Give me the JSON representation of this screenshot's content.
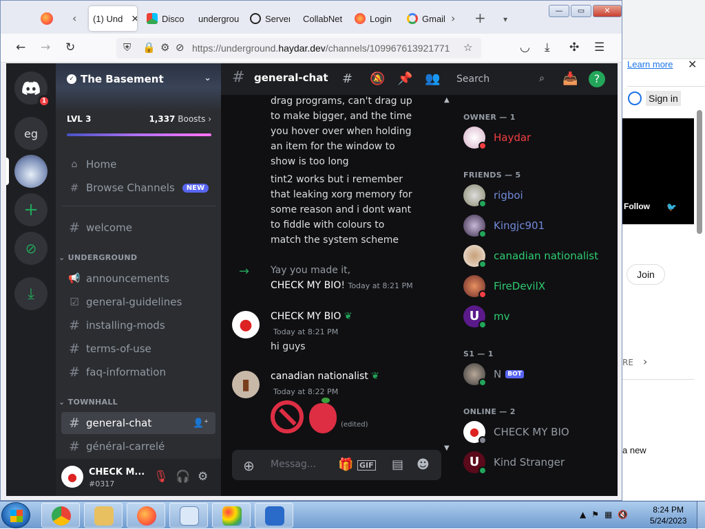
{
  "background_page": {
    "learn_more": "Learn more",
    "sign_in": "Sign in",
    "follow": "Follow",
    "join": "Join",
    "partial_text_1": "RE",
    "partial_text_2": "a new"
  },
  "browser": {
    "tabs": [
      {
        "label": "(1) Und",
        "active": true
      },
      {
        "label": "Disco"
      },
      {
        "label": "undergrou"
      },
      {
        "label": "Server"
      },
      {
        "label": "CollabNet"
      },
      {
        "label": "Login"
      },
      {
        "label": "Gmail"
      }
    ],
    "url_prefix": "https://underground.",
    "url_domain": "haydar.dev",
    "url_suffix": "/channels/109967613921771",
    "window_buttons": {
      "minimize": "—",
      "restore": "▭",
      "close": "✕"
    }
  },
  "discord": {
    "guild_badge": "1",
    "guild_eg": "eg",
    "server_name": "The Basement",
    "boost_level": "LVL 3",
    "boost_count": "1,337",
    "boost_word": "Boosts",
    "nav": {
      "home": "Home",
      "browse": "Browse Channels",
      "new_tag": "NEW"
    },
    "channels_top": [
      {
        "name": "welcome"
      }
    ],
    "categories": {
      "underground": "UNDERGROUND",
      "townhall": "TOWNHALL"
    },
    "channels_underground": [
      {
        "name": "announcements"
      },
      {
        "name": "general-guidelines"
      },
      {
        "name": "installing-mods"
      },
      {
        "name": "terms-of-use"
      },
      {
        "name": "faq-information"
      }
    ],
    "channels_townhall": [
      {
        "name": "general-chat",
        "active": true
      },
      {
        "name": "général-carrelé"
      }
    ],
    "current_user": {
      "name": "CHECK M...",
      "tag": "#0317"
    },
    "header": {
      "channel": "general-chat",
      "search_placeholder": "Search"
    },
    "messages": {
      "line1": "drag programs, can't drag up",
      "line2": "to make bigger, and the time",
      "line3": "you hover over when holding",
      "line4": "an item for the window to",
      "line5": "show is too long",
      "line6": "tint2 works but i remember",
      "line7": "that leaking xorg memory for",
      "line8": "some reason and i dont want",
      "line9": "to fiddle with colours to",
      "line10": "match the system scheme",
      "join_text": "Yay you made it,",
      "join_user": "CHECK MY BIO",
      "join_bang": "!",
      "join_time": "Today at 8:21 PM",
      "m1_author": "CHECK MY BIO",
      "m1_time": "Today at 8:21 PM",
      "m1_text": "hi guys",
      "m2_author": "canadian nationalist",
      "m2_time": "Today at 8:22 PM",
      "m2_edited": "(edited)"
    },
    "composer_placeholder": "Messag...",
    "members": {
      "owner_header": "OWNER — 1",
      "owner": [
        {
          "name": "Haydar",
          "color": "#f23f43"
        }
      ],
      "friends_header": "FRIENDS — 5",
      "friends": [
        {
          "name": "rigboi",
          "color": "#7289da"
        },
        {
          "name": "Kingjc901",
          "color": "#7289da"
        },
        {
          "name": "canadian nationalist",
          "color": "#2ecc71"
        },
        {
          "name": "FireDevilX",
          "color": "#2ecc71"
        },
        {
          "name": "mv",
          "color": "#2ecc71"
        }
      ],
      "s1_header": "S1 — 1",
      "s1": [
        {
          "name": "N",
          "bot": "BOT"
        }
      ],
      "online_header": "ONLINE — 2",
      "online": [
        {
          "name": "CHECK MY BIO"
        },
        {
          "name": "Kind Stranger"
        }
      ]
    }
  },
  "taskbar": {
    "time": "8:24 PM",
    "date": "5/24/2023"
  }
}
